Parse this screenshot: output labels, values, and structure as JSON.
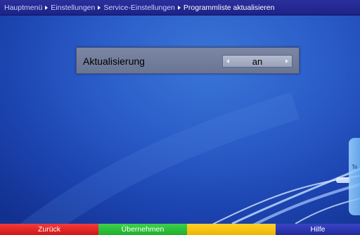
{
  "breadcrumb": {
    "items": [
      "Hauptmenü",
      "Einstellungen",
      "Service-Einstellungen",
      "Programmliste aktualisieren"
    ]
  },
  "setting": {
    "label": "Aktualisierung",
    "value": "an"
  },
  "color_buttons": {
    "red": "Zurück",
    "green": "Übernehmen",
    "yellow": "",
    "blue": "Hilfe"
  },
  "colors": {
    "red": "#e02424",
    "green": "#2cbf38",
    "yellow": "#f7c20f",
    "blue": "#2a33b0",
    "background": "#2a5cc8"
  },
  "decor": {
    "device_text": "Te"
  }
}
